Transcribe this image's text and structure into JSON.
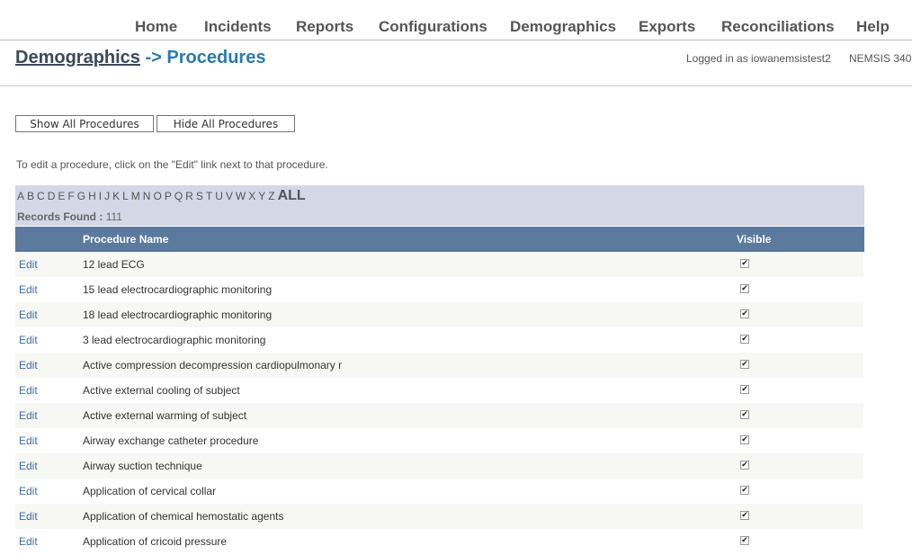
{
  "nav": [
    "Home",
    "Incidents",
    "Reports",
    "Configurations",
    "Demographics",
    "Exports",
    "Reconciliations",
    "Help"
  ],
  "breadcrumb": {
    "parent": "Demographics",
    "separator": "->",
    "current": "Procedures"
  },
  "user": {
    "logged_in": "Logged in as iowanemsistest2",
    "version": "NEMSIS 340"
  },
  "buttons": {
    "show_all": "Show All Procedures",
    "hide_all": "Hide All Procedures"
  },
  "instructions": "To edit a procedure, click on the \"Edit\" link next to that procedure.",
  "alphabet": [
    "A",
    "B",
    "C",
    "D",
    "E",
    "F",
    "G",
    "H",
    "I",
    "J",
    "K",
    "L",
    "M",
    "N",
    "O",
    "P",
    "Q",
    "R",
    "S",
    "T",
    "U",
    "V",
    "W",
    "X",
    "Y",
    "Z"
  ],
  "all_label": "ALL",
  "records": {
    "label": "Records Found :",
    "count": "111"
  },
  "table": {
    "headers": {
      "name": "Procedure Name",
      "visible": "Visible"
    },
    "edit_label": "Edit",
    "rows": [
      {
        "name": "12 lead ECG",
        "visible": true
      },
      {
        "name": "15 lead electrocardiographic monitoring",
        "visible": true
      },
      {
        "name": "18 lead electrocardiographic monitoring",
        "visible": true
      },
      {
        "name": "3 lead electrocardiographic monitoring",
        "visible": true
      },
      {
        "name": "Active compression decompression cardiopulmonary r",
        "visible": true
      },
      {
        "name": "Active external cooling of subject",
        "visible": true
      },
      {
        "name": "Active external warming of subject",
        "visible": true
      },
      {
        "name": "Airway exchange catheter procedure",
        "visible": true
      },
      {
        "name": "Airway suction technique",
        "visible": true
      },
      {
        "name": "Application of cervical collar",
        "visible": true
      },
      {
        "name": "Application of chemical hemostatic agents",
        "visible": true
      },
      {
        "name": "Application of cricoid pressure",
        "visible": true
      }
    ]
  }
}
